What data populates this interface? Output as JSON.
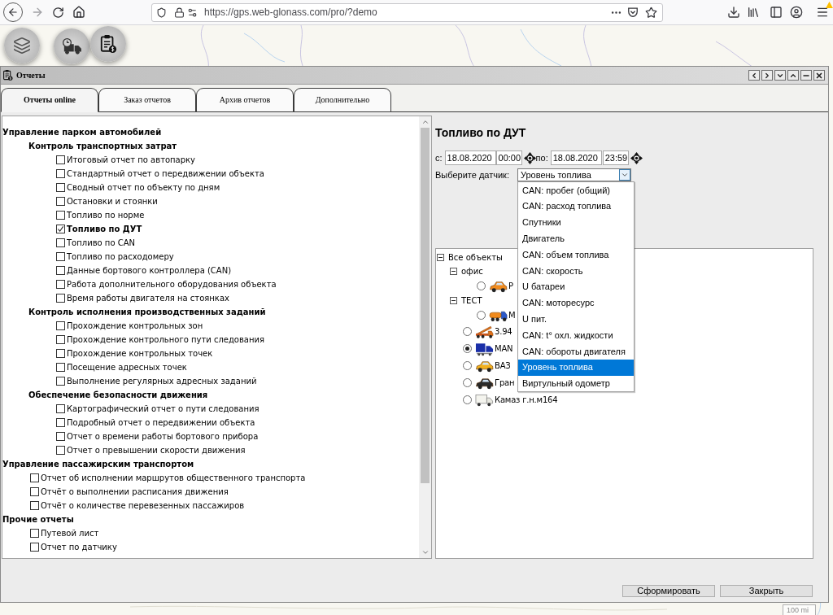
{
  "browser": {
    "url": "https://gps.web-glonass.com/pro/?demo"
  },
  "map": {
    "scale": "100 mi"
  },
  "window": {
    "title": "Отчеты",
    "tabs": [
      {
        "label": "Отчеты online",
        "selected": true
      },
      {
        "label": "Заказ отчетов",
        "selected": false
      },
      {
        "label": "Архив отчетов",
        "selected": false
      },
      {
        "label": "Дополнительно",
        "selected": false
      }
    ]
  },
  "report_tree": [
    {
      "label": "Управление парком автомобилей",
      "children": [
        {
          "label": "Контроль транспортных затрат",
          "children": [
            {
              "label": "Итоговый отчет по автопарку",
              "checked": false
            },
            {
              "label": "Стандартный отчет о передвижении объекта",
              "checked": false
            },
            {
              "label": "Сводный отчет по объекту по дням",
              "checked": false
            },
            {
              "label": "Остановки и стоянки",
              "checked": false
            },
            {
              "label": "Топливо по норме",
              "checked": false
            },
            {
              "label": "Топливо по ДУТ",
              "checked": true
            },
            {
              "label": "Топливо по CAN",
              "checked": false
            },
            {
              "label": "Топливо по расходомеру",
              "checked": false
            },
            {
              "label": "Данные бортового контроллера (CAN)",
              "checked": false
            },
            {
              "label": "Работа дополнительного оборудования объекта",
              "checked": false
            },
            {
              "label": "Время работы двигателя на стоянках",
              "checked": false
            }
          ]
        },
        {
          "label": "Контроль исполнения производственных заданий",
          "children": [
            {
              "label": "Прохождение контрольных зон",
              "checked": false
            },
            {
              "label": "Прохождение контрольного пути следования",
              "checked": false
            },
            {
              "label": "Прохождение контрольных точек",
              "checked": false
            },
            {
              "label": "Посещение адресных точек",
              "checked": false
            },
            {
              "label": "Выполнение регулярных адресных заданий",
              "checked": false
            }
          ]
        },
        {
          "label": "Обеспечение безопасности движения",
          "children": [
            {
              "label": "Картографический отчет о пути следования",
              "checked": false
            },
            {
              "label": "Подробный отчет о передвижении объекта",
              "checked": false
            },
            {
              "label": "Отчет о времени работы бортового прибора",
              "checked": false
            },
            {
              "label": "Отчет о превышении скорости движения",
              "checked": false
            }
          ]
        }
      ]
    },
    {
      "label": "Управление пассажирским транспортом",
      "children": [
        {
          "label": "Отчет об исполнении маршрутов общественного транспорта",
          "checked": false
        },
        {
          "label": "Отчёт о выполнении расписания движения",
          "checked": false
        },
        {
          "label": "Отчёт о количестве перевезенных пассажиров",
          "checked": false
        }
      ]
    },
    {
      "label": "Прочие отчеты",
      "children": [
        {
          "label": "Путевой лист",
          "checked": false
        },
        {
          "label": "Отчет по датчику",
          "checked": false
        }
      ]
    }
  ],
  "report": {
    "title": "Топливо по ДУТ",
    "from_label": "с:",
    "from_date": "18.08.2020",
    "from_time": "00:00",
    "to_label": "по:",
    "to_date": "18.08.2020",
    "to_time": "23:59",
    "sensor_label": "Выберите датчик:",
    "sensor_value": "Уровень топлива",
    "sensor_options": [
      {
        "label": "CAN: пробег (общий)",
        "selected": false
      },
      {
        "label": "CAN: расход топлива",
        "selected": false
      },
      {
        "label": "Спутники",
        "selected": false
      },
      {
        "label": "Двигатель",
        "selected": false
      },
      {
        "label": "CAN: объем топлива",
        "selected": false
      },
      {
        "label": "CAN: скорость",
        "selected": false
      },
      {
        "label": "U батареи",
        "selected": false
      },
      {
        "label": "CAN: моторесурс",
        "selected": false
      },
      {
        "label": "U пит.",
        "selected": false
      },
      {
        "label": "CAN: t° охл. жидкости",
        "selected": false
      },
      {
        "label": "CAN: обороты двигателя",
        "selected": false
      },
      {
        "label": "Уровень топлива",
        "selected": true
      },
      {
        "label": "Виртульный одометр",
        "selected": false
      }
    ]
  },
  "objects": [
    {
      "kind": "group",
      "label": "Все объекты",
      "expanded": true,
      "children": [
        {
          "kind": "group",
          "label": "офис",
          "expanded": true,
          "children": [
            {
              "kind": "object",
              "label": "Р",
              "selected": false
            }
          ]
        },
        {
          "kind": "group",
          "label": "ТЕСТ",
          "expanded": true,
          "children": [
            {
              "kind": "object",
              "label": "М",
              "selected": false
            }
          ]
        },
        {
          "kind": "object",
          "label": "3.94",
          "selected": false
        },
        {
          "kind": "object",
          "label": "MAN",
          "selected": true
        },
        {
          "kind": "object",
          "label": "ВАЗ",
          "selected": false
        },
        {
          "kind": "object",
          "label": "Гран",
          "selected": false
        },
        {
          "kind": "object",
          "label": "Камаз г.н.м164",
          "selected": false
        }
      ]
    }
  ],
  "buttons": [
    "Сформировать",
    "Закрыть"
  ]
}
